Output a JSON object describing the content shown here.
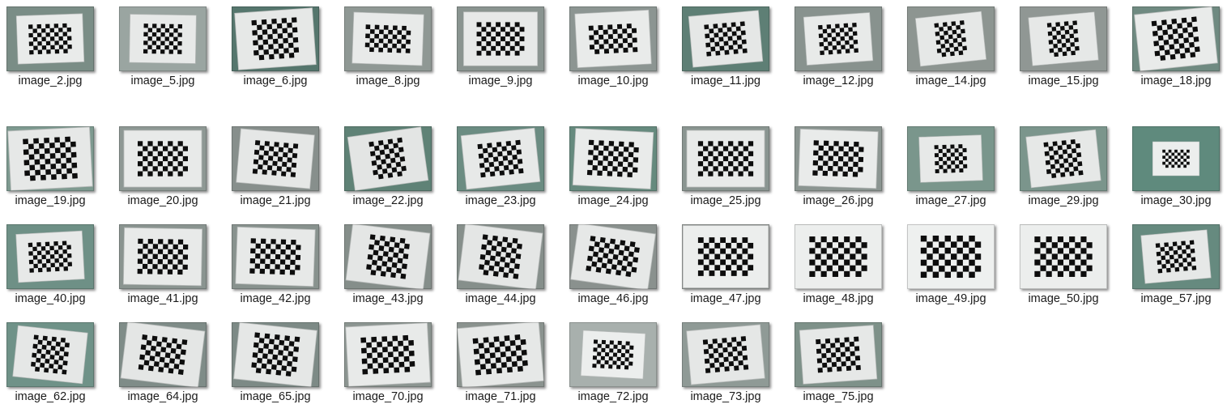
{
  "gallery": {
    "files": [
      {
        "name": "image_2.jpg",
        "wall": "#7a8d86",
        "board": "#e9ebea",
        "tilt": -2,
        "scale": 0.85,
        "cols": 10,
        "rows": 7
      },
      {
        "name": "image_5.jpg",
        "wall": "#9aa5a1",
        "board": "#e7e9e8",
        "tilt": 1,
        "scale": 0.85,
        "cols": 9,
        "rows": 7
      },
      {
        "name": "image_6.jpg",
        "wall": "#55766d",
        "board": "#e6e8e7",
        "tilt": -4,
        "scale": 1.0,
        "cols": 9,
        "rows": 8
      },
      {
        "name": "image_8.jpg",
        "wall": "#8f9894",
        "board": "#e8eae9",
        "tilt": 2,
        "scale": 0.9,
        "cols": 10,
        "rows": 6
      },
      {
        "name": "image_9.jpg",
        "wall": "#8a9490",
        "board": "#e7e9e8",
        "tilt": 0,
        "scale": 0.95,
        "cols": 10,
        "rows": 7
      },
      {
        "name": "image_10.jpg",
        "wall": "#8c9592",
        "board": "#e9ebea",
        "tilt": -3,
        "scale": 0.95,
        "cols": 10,
        "rows": 6
      },
      {
        "name": "image_11.jpg",
        "wall": "#5e7f75",
        "board": "#e5e7e6",
        "tilt": -5,
        "scale": 0.9,
        "cols": 9,
        "rows": 7
      },
      {
        "name": "image_12.jpg",
        "wall": "#88928e",
        "board": "#e8eae9",
        "tilt": -4,
        "scale": 0.85,
        "cols": 9,
        "rows": 7
      },
      {
        "name": "image_14.jpg",
        "wall": "#8d9591",
        "board": "#e6e8e7",
        "tilt": -6,
        "scale": 0.85,
        "cols": 7,
        "rows": 8
      },
      {
        "name": "image_15.jpg",
        "wall": "#909794",
        "board": "#e6e8e7",
        "tilt": -5,
        "scale": 0.85,
        "cols": 7,
        "rows": 8
      },
      {
        "name": "image_18.jpg",
        "wall": "#6f8a81",
        "board": "#e9ebea",
        "tilt": -6,
        "scale": 1.0,
        "cols": 9,
        "rows": 8
      },
      {
        "name": "image_19.jpg",
        "wall": "#7e9a90",
        "board": "#e6e8e7",
        "tilt": -3,
        "scale": 1.05,
        "cols": 10,
        "rows": 8
      },
      {
        "name": "image_20.jpg",
        "wall": "#8e9894",
        "board": "#e8eae9",
        "tilt": 0,
        "scale": 1.0,
        "cols": 10,
        "rows": 7
      },
      {
        "name": "image_21.jpg",
        "wall": "#878f8c",
        "board": "#e5e7e6",
        "tilt": 5,
        "scale": 0.95,
        "cols": 9,
        "rows": 7
      },
      {
        "name": "image_22.jpg",
        "wall": "#5f8276",
        "board": "#e3e5e4",
        "tilt": -8,
        "scale": 0.95,
        "cols": 7,
        "rows": 8
      },
      {
        "name": "image_23.jpg",
        "wall": "#6b8c82",
        "board": "#e7e9e8",
        "tilt": -6,
        "scale": 0.95,
        "cols": 9,
        "rows": 7
      },
      {
        "name": "image_24.jpg",
        "wall": "#668a7e",
        "board": "#e9ebea",
        "tilt": 3,
        "scale": 1.0,
        "cols": 10,
        "rows": 7
      },
      {
        "name": "image_25.jpg",
        "wall": "#8a9591",
        "board": "#e8eae9",
        "tilt": 0,
        "scale": 1.0,
        "cols": 11,
        "rows": 7
      },
      {
        "name": "image_26.jpg",
        "wall": "#8b9591",
        "board": "#e9ebea",
        "tilt": 2,
        "scale": 1.0,
        "cols": 10,
        "rows": 7
      },
      {
        "name": "image_27.jpg",
        "wall": "#7a968c",
        "board": "#e7e9e8",
        "tilt": -2,
        "scale": 0.8,
        "cols": 8,
        "rows": 7
      },
      {
        "name": "image_29.jpg",
        "wall": "#7b958c",
        "board": "#e6e8e7",
        "tilt": -6,
        "scale": 0.9,
        "cols": 8,
        "rows": 8
      },
      {
        "name": "image_30.jpg",
        "wall": "#5f8a7d",
        "board": "#eceeed",
        "tilt": 0,
        "scale": 0.6,
        "cols": 9,
        "rows": 6
      },
      {
        "name": "image_40.jpg",
        "wall": "#6e9086",
        "board": "#e7e9e8",
        "tilt": -3,
        "scale": 0.85,
        "cols": 10,
        "rows": 7
      },
      {
        "name": "image_41.jpg",
        "wall": "#8a9490",
        "board": "#e8eae9",
        "tilt": 1,
        "scale": 1.0,
        "cols": 10,
        "rows": 7
      },
      {
        "name": "image_42.jpg",
        "wall": "#88928e",
        "board": "#e7e9e8",
        "tilt": 2,
        "scale": 1.0,
        "cols": 10,
        "rows": 7
      },
      {
        "name": "image_43.jpg",
        "wall": "#858e8a",
        "board": "#e4e6e5",
        "tilt": 7,
        "scale": 1.0,
        "cols": 8,
        "rows": 8
      },
      {
        "name": "image_44.jpg",
        "wall": "#868f8b",
        "board": "#e4e6e5",
        "tilt": 7,
        "scale": 1.0,
        "cols": 8,
        "rows": 8
      },
      {
        "name": "image_46.jpg",
        "wall": "#8a918e",
        "board": "#e6e8e7",
        "tilt": 8,
        "scale": 1.0,
        "cols": 10,
        "rows": 7
      },
      {
        "name": "image_47.jpg",
        "wall": "#9aa09d",
        "board": "#eceeed",
        "tilt": 0,
        "scale": 1.1,
        "cols": 10,
        "rows": 7
      },
      {
        "name": "image_48.jpg",
        "wall": "#a0a6a3",
        "board": "#eceeed",
        "tilt": 0,
        "scale": 1.15,
        "cols": 10,
        "rows": 7
      },
      {
        "name": "image_49.jpg",
        "wall": "#d6d8d7",
        "board": "#eef0ef",
        "tilt": 0,
        "scale": 1.2,
        "cols": 10,
        "rows": 7
      },
      {
        "name": "image_50.jpg",
        "wall": "#cfd2d0",
        "board": "#eceeed",
        "tilt": 0,
        "scale": 1.15,
        "cols": 10,
        "rows": 7
      },
      {
        "name": "image_57.jpg",
        "wall": "#668a7f",
        "board": "#e6e8e7",
        "tilt": -5,
        "scale": 0.85,
        "cols": 9,
        "rows": 7
      },
      {
        "name": "image_62.jpg",
        "wall": "#6f9288",
        "board": "#e5e7e6",
        "tilt": 6,
        "scale": 0.9,
        "cols": 8,
        "rows": 8
      },
      {
        "name": "image_64.jpg",
        "wall": "#7f8c88",
        "board": "#e4e6e5",
        "tilt": 7,
        "scale": 1.0,
        "cols": 9,
        "rows": 7
      },
      {
        "name": "image_65.jpg",
        "wall": "#7d8a86",
        "board": "#e5e7e6",
        "tilt": 6,
        "scale": 1.0,
        "cols": 9,
        "rows": 8
      },
      {
        "name": "image_70.jpg",
        "wall": "#8c9591",
        "board": "#e8eae9",
        "tilt": -3,
        "scale": 1.05,
        "cols": 10,
        "rows": 7
      },
      {
        "name": "image_71.jpg",
        "wall": "#8b938f",
        "board": "#e6e8e7",
        "tilt": -5,
        "scale": 1.05,
        "cols": 10,
        "rows": 7
      },
      {
        "name": "image_72.jpg",
        "wall": "#a8b0ad",
        "board": "#eceeed",
        "tilt": 3,
        "scale": 0.8,
        "cols": 10,
        "rows": 7
      },
      {
        "name": "image_73.jpg",
        "wall": "#8f9a96",
        "board": "#e5e7e6",
        "tilt": -5,
        "scale": 0.95,
        "cols": 9,
        "rows": 7
      },
      {
        "name": "image_75.jpg",
        "wall": "#7e9189",
        "board": "#e6e8e7",
        "tilt": -4,
        "scale": 0.95,
        "cols": 9,
        "rows": 7
      }
    ]
  }
}
